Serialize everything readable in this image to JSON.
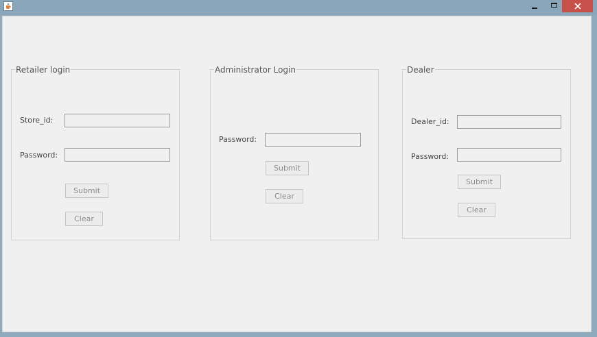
{
  "window": {
    "icon": "java-cup-icon",
    "controls": {
      "minimize": "minimize-icon",
      "maximize": "maximize-icon",
      "close": "close-icon"
    }
  },
  "panels": {
    "retailer": {
      "title": "Retailer login",
      "store_id_label": "Store_id:",
      "store_id_value": "",
      "password_label": "Password:",
      "password_value": "",
      "submit_label": "Submit",
      "clear_label": "Clear"
    },
    "administrator": {
      "title": "Administrator Login",
      "password_label": "Password:",
      "password_value": "",
      "submit_label": "Submit",
      "clear_label": "Clear"
    },
    "dealer": {
      "title": "Dealer",
      "dealer_id_label": "Dealer_id:",
      "dealer_id_value": "",
      "password_label": "Password:",
      "password_value": "",
      "submit_label": "Submit",
      "clear_label": "Clear"
    }
  },
  "colors": {
    "title_bar": "#8aa6ba",
    "close_button": "#c7504a",
    "content_background": "#f0f0f0"
  }
}
